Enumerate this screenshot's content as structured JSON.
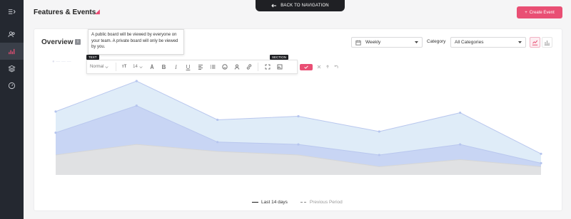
{
  "colors": {
    "accent": "#e94f74",
    "sidebar": "#242830",
    "area_top": "#dbeaf7",
    "area_mid": "#c5d3f3",
    "area_base": "#e2e2e2"
  },
  "sidebar": {
    "items": [
      {
        "icon": "menu-collapse-icon"
      },
      {
        "icon": "users-icon"
      },
      {
        "icon": "bar-chart-icon",
        "active": true
      },
      {
        "icon": "layers-icon"
      },
      {
        "icon": "dashboard-icon"
      }
    ]
  },
  "header": {
    "title": "Features & Events",
    "back_label": "BACK TO NAVIGATION",
    "create_label": "Create Event"
  },
  "card": {
    "title": "Overview",
    "info_mark": "i",
    "tooltip_text": "A public board will be viewed by everyone on your team. A private board will only be viewed by you.",
    "text_label": "TEXT",
    "section_label": "SECTION",
    "toolbar": {
      "style_value": "Normal",
      "size_value": "14"
    },
    "period": {
      "value": "Weekly"
    },
    "category": {
      "label": "Category",
      "value": "All Categories"
    }
  },
  "chart_data": {
    "type": "area",
    "x_count": 8,
    "series": [
      {
        "values": [
          54,
          80,
          47,
          50,
          37,
          53,
          18
        ],
        "color": "#dbeaf7"
      },
      {
        "values": [
          36,
          59,
          28,
          26,
          17,
          26,
          10
        ],
        "color": "#c5d3f3"
      },
      {
        "values": [
          17,
          26,
          20,
          17,
          7,
          13,
          7
        ],
        "color": "#e2e2e2"
      }
    ],
    "x_points": 7,
    "ylim": [
      0,
      100
    ],
    "legend": [
      {
        "label": "Last 14 days",
        "style": "solid"
      },
      {
        "label": "Previous Period",
        "style": "dashed"
      }
    ],
    "grid": false
  }
}
